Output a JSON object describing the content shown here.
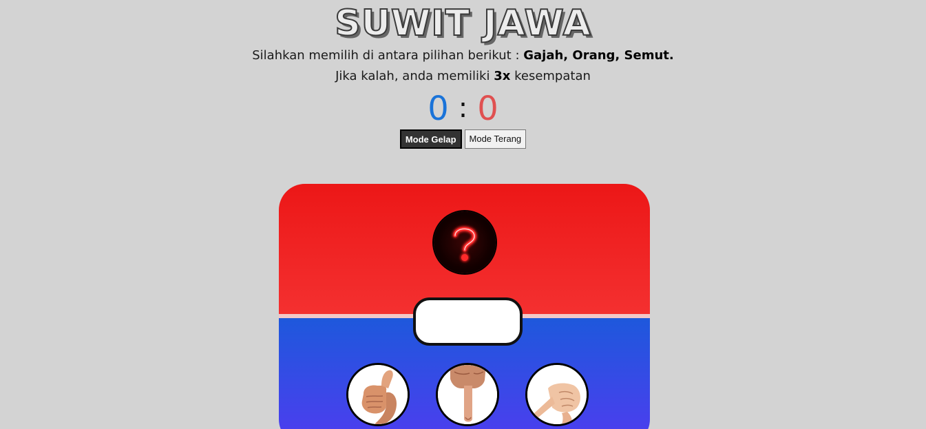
{
  "header": {
    "title": "SUWIT JAWA",
    "line1_prefix": "Silahkan memilih di antara pilihan berikut :",
    "line1_choices": "Gajah, Orang, Semut.",
    "line2_prefix": "Jika kalah, anda memiliki",
    "line2_chances": "3x",
    "line2_suffix": "kesempatan"
  },
  "score": {
    "player": "0",
    "separator": ":",
    "computer": "0"
  },
  "modes": {
    "dark_label": "Mode Gelap",
    "light_label": "Mode Terang"
  },
  "board": {
    "computer_choice_icon": "question-mark-icon",
    "result_text": "",
    "choices": [
      {
        "name": "gajah",
        "icon": "thumb-hand-icon"
      },
      {
        "name": "orang",
        "icon": "index-finger-hand-icon"
      },
      {
        "name": "semut",
        "icon": "pinky-finger-hand-icon"
      }
    ]
  },
  "colors": {
    "background": "#d3d3d3",
    "player_score": "#1a73d9",
    "computer_score": "#e05050",
    "board_top": "#ec1717",
    "board_bottom": "#1e58dc"
  }
}
